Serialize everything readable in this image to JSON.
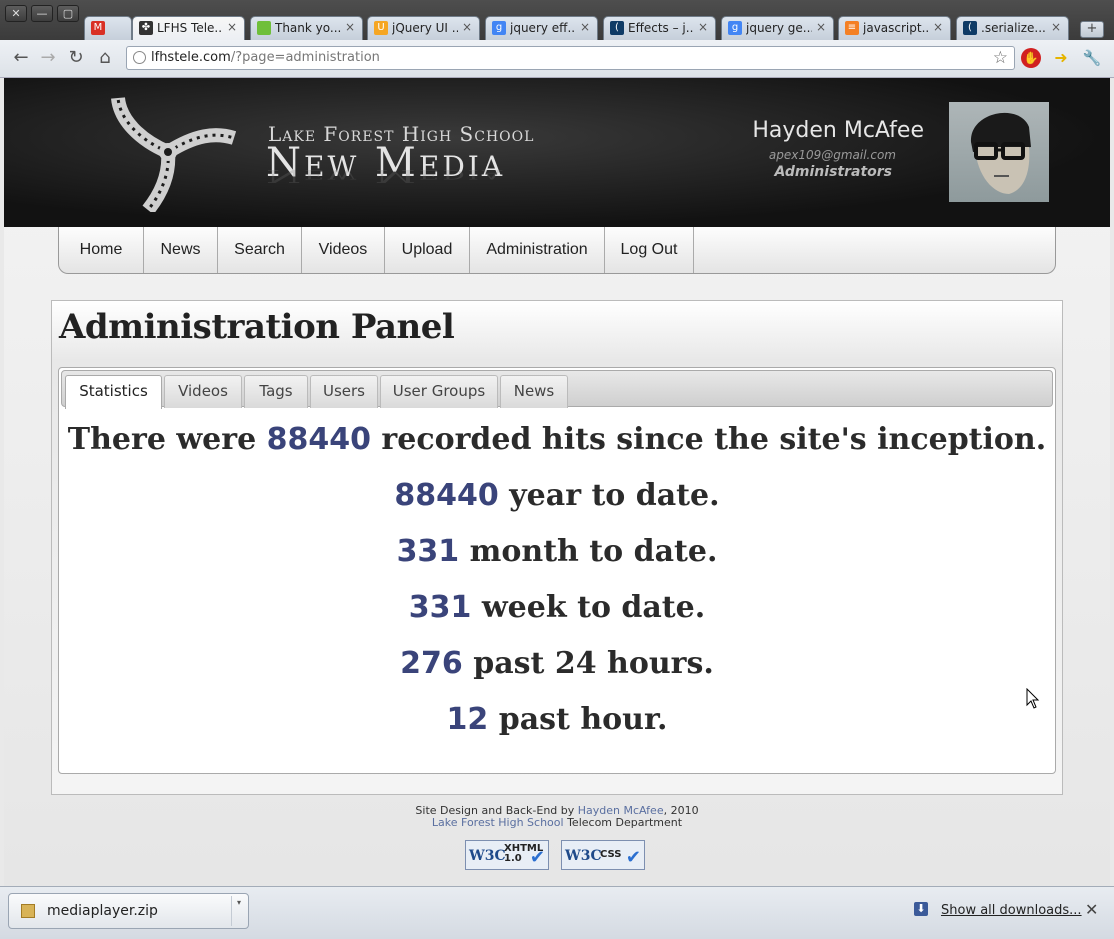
{
  "browser": {
    "window_buttons": [
      "✕",
      "—",
      "▢"
    ],
    "tabs": [
      {
        "title": "",
        "favicon": "gmail-icon",
        "color": "#d93025",
        "glyph": "M"
      },
      {
        "title": "LFHS Tele...",
        "favicon": "film-icon",
        "color": "#333333",
        "glyph": "✤"
      },
      {
        "title": "Thank yo...",
        "favicon": "page-icon",
        "color": "#6fbf3a",
        "glyph": ""
      },
      {
        "title": "jQuery UI ...",
        "favicon": "jquery-ui-icon",
        "color": "#f5a623",
        "glyph": "U"
      },
      {
        "title": "jquery eff...",
        "favicon": "google-icon",
        "color": "#4285f4",
        "glyph": "g"
      },
      {
        "title": "Effects – j...",
        "favicon": "jquery-icon",
        "color": "#0f3b66",
        "glyph": "("
      },
      {
        "title": "jquery ge...",
        "favicon": "google-icon",
        "color": "#4285f4",
        "glyph": "g"
      },
      {
        "title": "javascript...",
        "favicon": "stackoverflow-icon",
        "color": "#f48024",
        "glyph": "≡"
      },
      {
        "title": ".serialize...",
        "favicon": "jquery-icon",
        "color": "#0f3b66",
        "glyph": "("
      }
    ],
    "new_tab": "+",
    "tab_close": "×",
    "nav": {
      "back": "←",
      "forward": "→",
      "reload": "↻",
      "home": "⌂"
    },
    "url_host": "lfhstele.com",
    "url_path": "/?page=administration",
    "star": "☆",
    "wrench": "🔧"
  },
  "site": {
    "school_name": "Lake Forest High School",
    "media_name": "New Media",
    "user": {
      "name": "Hayden McAfee",
      "email": "apex109@gmail.com",
      "group": "Administrators"
    },
    "nav": [
      "Home",
      "News",
      "Search",
      "Videos",
      "Upload",
      "Administration",
      "Log Out"
    ]
  },
  "panel": {
    "title": "Administration Panel",
    "tabs": [
      "Statistics",
      "Videos",
      "Tags",
      "Users",
      "User Groups",
      "News"
    ],
    "active_tab": "Statistics",
    "stats": [
      {
        "prefix": "There were ",
        "num": "88440",
        "suffix": " recorded hits since the site's inception."
      },
      {
        "prefix": "",
        "num": "88440",
        "suffix": " year to date."
      },
      {
        "prefix": "",
        "num": "331",
        "suffix": " month to date."
      },
      {
        "prefix": "",
        "num": "331",
        "suffix": " week to date."
      },
      {
        "prefix": "",
        "num": "276",
        "suffix": " past 24 hours."
      },
      {
        "prefix": "",
        "num": "12",
        "suffix": " past hour."
      }
    ]
  },
  "footer": {
    "line1_pre": "Site Design and Back-End by ",
    "line1_link": "Hayden McAfee",
    "line1_post": ", 2010",
    "line2_link": "Lake Forest High School",
    "line2_post": " Telecom Department",
    "badges": [
      {
        "w3c": "W3C",
        "kind_line1": "XHTML",
        "kind_line2": "1.0"
      },
      {
        "w3c": "W3C",
        "kind_line1": "CSS",
        "kind_line2": ""
      }
    ]
  },
  "downloads": {
    "file": "mediaplayer.zip",
    "show_all": "Show all downloads...",
    "close": "✕"
  }
}
